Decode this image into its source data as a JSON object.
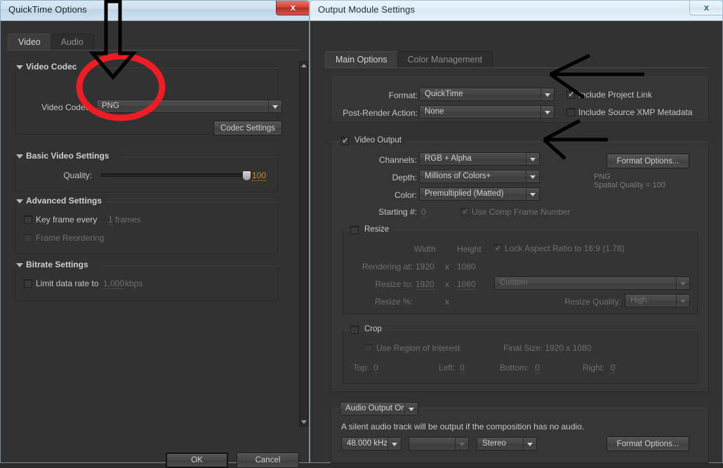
{
  "quicktime": {
    "title": "QuickTime Options",
    "close_label": "x",
    "tabs": [
      {
        "label": "Video",
        "active": true
      },
      {
        "label": "Audio",
        "active": false
      }
    ],
    "sections": {
      "video_codec": {
        "header": "Video Codec",
        "codec_label": "Video Codec:",
        "codec_value": "PNG",
        "codec_settings_button": "Codec Settings"
      },
      "basic_video": {
        "header": "Basic Video Settings",
        "quality_label": "Quality:",
        "quality_value": "100"
      },
      "advanced": {
        "header": "Advanced Settings",
        "key_frame_label": "Key frame every",
        "key_frame_value": "1",
        "key_frame_units": "frames",
        "frame_reordering_label": "Frame Reordering"
      },
      "bitrate": {
        "header": "Bitrate Settings",
        "limit_label": "Limit data rate to",
        "limit_value": "1,000",
        "limit_units": "kbps"
      }
    },
    "footer": {
      "ok_label": "OK",
      "cancel_label": "Cancel"
    }
  },
  "output_module": {
    "title": "Output Module Settings",
    "close_label": "x",
    "tabs": [
      {
        "label": "Main Options",
        "active": true
      },
      {
        "label": "Color Management",
        "active": false
      }
    ],
    "format_group": {
      "format_label": "Format:",
      "format_value": "QuickTime",
      "post_render_label": "Post-Render Action:",
      "post_render_value": "None",
      "include_project_link_label": "Include Project Link",
      "include_xmp_label": "Include Source XMP Metadata"
    },
    "video_output": {
      "group_title": "Video Output",
      "channels_label": "Channels:",
      "channels_value": "RGB + Alpha",
      "depth_label": "Depth:",
      "depth_value": "Millions of Colors+",
      "color_label": "Color:",
      "color_value": "Premultiplied (Matted)",
      "starting_label": "Starting #:",
      "starting_value": "0",
      "use_comp_frame_label": "Use Comp Frame Number",
      "format_options_button": "Format Options...",
      "codec_info_line1": "PNG",
      "codec_info_line2": "Spatial Quality = 100"
    },
    "resize": {
      "group_title": "Resize",
      "width_header": "Width",
      "height_header": "Height",
      "lock_aspect_label": "Lock Aspect Ratio to 16:9 (1.78)",
      "rendering_at_label": "Rendering at:",
      "rendering_width": "1920",
      "rendering_x": "x",
      "rendering_height": "1080",
      "resize_to_label": "Resize to:",
      "resize_width": "1920",
      "resize_x": "x",
      "resize_height": "1080",
      "preset_value": "Custom",
      "resize_pct_label": "Resize %:",
      "resize_pct_x": "x",
      "resize_quality_label": "Resize Quality:",
      "resize_quality_value": "High"
    },
    "crop": {
      "group_title": "Crop",
      "use_roi_label": "Use Region of Interest",
      "final_size_label": "Final Size: 1920 x 1080",
      "top_label": "Top:",
      "top_value": "0",
      "left_label": "Left:",
      "left_value": "0",
      "bottom_label": "Bottom:",
      "bottom_value": "0",
      "right_label": "Right:",
      "right_value": "0"
    },
    "audio": {
      "toggle_value": "Audio Output On",
      "note": "A silent audio track will be output if the composition has no audio.",
      "rate_value": "48.000 kHz",
      "bits_value": "",
      "channels_value": "Stereo",
      "format_options_button": "Format Options..."
    }
  },
  "annotations": {
    "ellipse_color": "#ee1c24",
    "arrow_color": "#000000",
    "items": [
      {
        "name": "down-arrow-to-codec",
        "shape": "outlined-down-arrow"
      },
      {
        "name": "ellipse-around-codec",
        "shape": "ellipse"
      },
      {
        "name": "left-arrow-to-format",
        "shape": "left-arrow"
      },
      {
        "name": "left-arrow-to-channels",
        "shape": "left-arrow"
      }
    ]
  }
}
